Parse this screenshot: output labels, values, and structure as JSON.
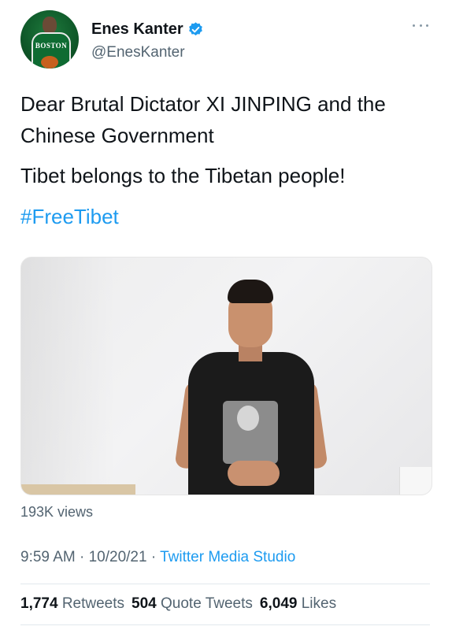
{
  "author": {
    "display_name": "Enes Kanter",
    "handle": "@EnesKanter",
    "avatar_jersey_text": "BOSTON"
  },
  "tweet": {
    "line1": "Dear Brutal Dictator XI JINPING and the Chinese Government",
    "line2": "Tibet belongs to the Tibetan people!",
    "hashtag": "#FreeTibet"
  },
  "media": {
    "views": "193K views"
  },
  "meta": {
    "time": "9:59 AM",
    "separator": " · ",
    "date": "10/20/21",
    "source": "Twitter Media Studio"
  },
  "stats": {
    "retweets_count": "1,774",
    "retweets_label": "Retweets",
    "quotes_count": "504",
    "quotes_label": "Quote Tweets",
    "likes_count": "6,049",
    "likes_label": "Likes"
  },
  "colors": {
    "accent": "#1d9bf0",
    "secondary_text": "#536471",
    "primary_text": "#0f1419"
  }
}
